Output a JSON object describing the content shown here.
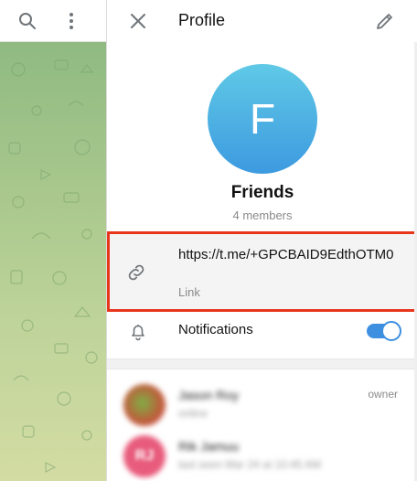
{
  "left_toolbar": {
    "search_icon": "search-icon",
    "more_icon": "more-vertical-icon"
  },
  "profile": {
    "title": "Profile",
    "avatar_letter": "F",
    "avatar_colors": [
      "#60c9e6",
      "#3d9ae0"
    ],
    "group_name": "Friends",
    "members_count": "4 members",
    "invite_link": "https://t.me/+GPCBAID9EdthOTM0",
    "invite_link_caption": "Link",
    "notifications_label": "Notifications",
    "notifications_enabled": true,
    "highlight_color": "#e8361d",
    "accent_color": "#3e8fe0"
  },
  "members": [
    {
      "name": "Jason Roy",
      "status": "online",
      "role": "owner"
    },
    {
      "name": "Rik Jamuu",
      "status": "last seen Mar 24 at 10:45 AM",
      "role": "",
      "initials": "RJ"
    }
  ]
}
